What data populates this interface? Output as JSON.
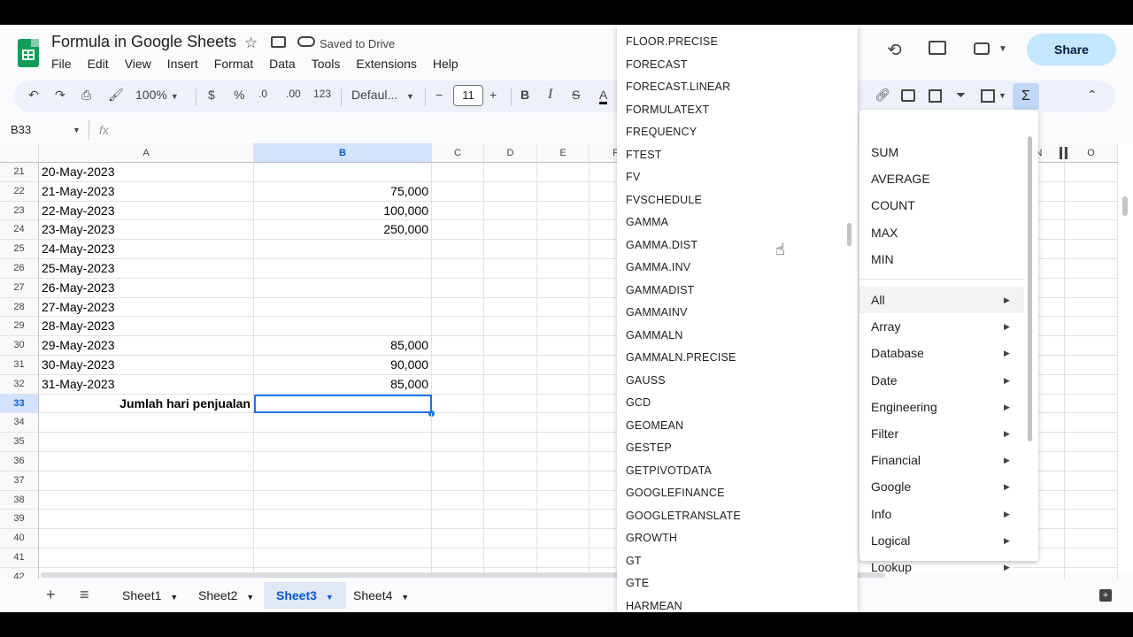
{
  "title_bar": {
    "doc_title": "Formula in Google Sheets",
    "saved_status": "Saved to Drive",
    "share_label": "Share"
  },
  "menu": [
    "File",
    "Edit",
    "View",
    "Insert",
    "Format",
    "Data",
    "Tools",
    "Extensions",
    "Help"
  ],
  "toolbar": {
    "zoom": "100%",
    "currency": "$",
    "percent": "%",
    "dec_decrease": ".0",
    "dec_increase": ".00",
    "number_format": "123",
    "font": "Defaul...",
    "font_size": "11",
    "bold": "B",
    "italic": "I",
    "sigma": "Σ"
  },
  "formula_bar": {
    "name_box": "B33",
    "fx": "fx"
  },
  "columns": [
    "A",
    "B",
    "C",
    "D",
    "E",
    "F",
    "N",
    "O"
  ],
  "rows": [
    {
      "num": "21",
      "a": "20-May-2023",
      "b": ""
    },
    {
      "num": "22",
      "a": "21-May-2023",
      "b": "75,000"
    },
    {
      "num": "23",
      "a": "22-May-2023",
      "b": "100,000"
    },
    {
      "num": "24",
      "a": "23-May-2023",
      "b": "250,000"
    },
    {
      "num": "25",
      "a": "24-May-2023",
      "b": ""
    },
    {
      "num": "26",
      "a": "25-May-2023",
      "b": ""
    },
    {
      "num": "27",
      "a": "26-May-2023",
      "b": ""
    },
    {
      "num": "28",
      "a": "27-May-2023",
      "b": ""
    },
    {
      "num": "29",
      "a": "28-May-2023",
      "b": ""
    },
    {
      "num": "30",
      "a": "29-May-2023",
      "b": "85,000"
    },
    {
      "num": "31",
      "a": "30-May-2023",
      "b": "90,000"
    },
    {
      "num": "32",
      "a": "31-May-2023",
      "b": "85,000"
    },
    {
      "num": "33",
      "a": "Jumlah hari penjualan",
      "b": ""
    },
    {
      "num": "34",
      "a": "",
      "b": ""
    },
    {
      "num": "35",
      "a": "",
      "b": ""
    },
    {
      "num": "36",
      "a": "",
      "b": ""
    },
    {
      "num": "37",
      "a": "",
      "b": ""
    },
    {
      "num": "38",
      "a": "",
      "b": ""
    },
    {
      "num": "39",
      "a": "",
      "b": ""
    },
    {
      "num": "40",
      "a": "",
      "b": ""
    },
    {
      "num": "41",
      "a": "",
      "b": ""
    },
    {
      "num": "42",
      "a": "",
      "b": ""
    }
  ],
  "sheet_tabs": [
    "Sheet1",
    "Sheet2",
    "Sheet3",
    "Sheet4"
  ],
  "active_sheet": "Sheet3",
  "function_list": [
    "FLOOR.PRECISE",
    "FORECAST",
    "FORECAST.LINEAR",
    "FORMULATEXT",
    "FREQUENCY",
    "FTEST",
    "FV",
    "FVSCHEDULE",
    "GAMMA",
    "GAMMA.DIST",
    "GAMMA.INV",
    "GAMMADIST",
    "GAMMAINV",
    "GAMMALN",
    "GAMMALN.PRECISE",
    "GAUSS",
    "GCD",
    "GEOMEAN",
    "GESTEP",
    "GETPIVOTDATA",
    "GOOGLEFINANCE",
    "GOOGLETRANSLATE",
    "GROWTH",
    "GT",
    "GTE",
    "HARMEAN"
  ],
  "sigma_menu": {
    "quick": [
      "SUM",
      "AVERAGE",
      "COUNT",
      "MAX",
      "MIN"
    ],
    "categories": [
      "All",
      "Array",
      "Database",
      "Date",
      "Engineering",
      "Filter",
      "Financial",
      "Google",
      "Info",
      "Logical",
      "Lookup"
    ]
  },
  "colors": {
    "accent": "#0b57d0",
    "share_bg": "#c2e7ff",
    "selection_header": "#d3e3fd",
    "sheets_green": "#0f9d58"
  }
}
